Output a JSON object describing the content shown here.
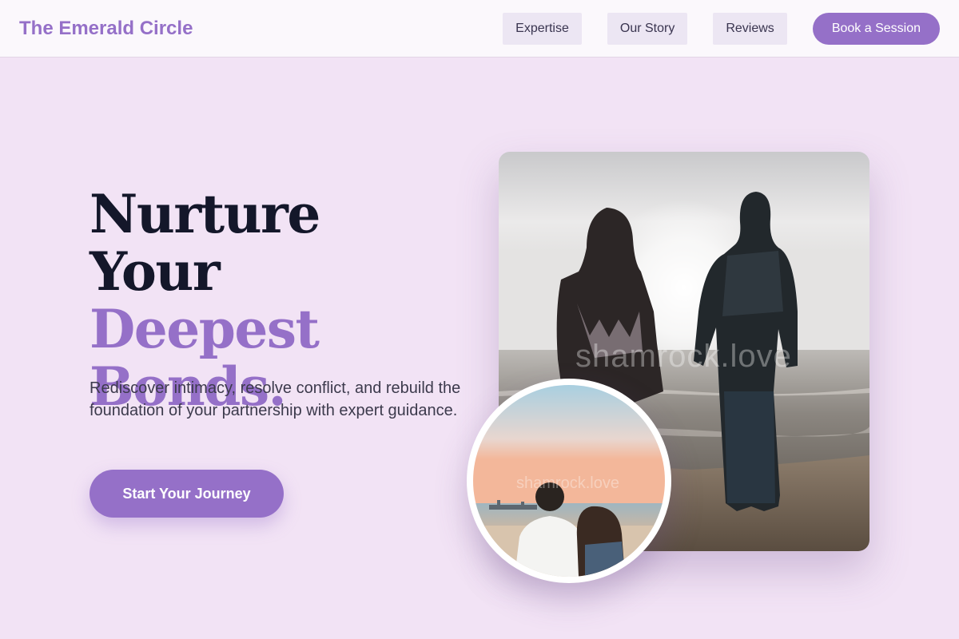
{
  "header": {
    "brand": "The Emerald Circle",
    "nav": [
      "Expertise",
      "Our Story",
      "Reviews"
    ],
    "cta": "Book a Session"
  },
  "hero": {
    "title_line1": "Nurture Your",
    "title_line2": "Deepest",
    "title_line3": "Bonds.",
    "subtitle": "Rediscover intimacy, resolve conflict, and rebuild the foundation of your partnership with expert guidance.",
    "cta": "Start Your Journey"
  },
  "images": {
    "main_watermark": "shamrock.love",
    "circle_watermark": "shamrock.love"
  },
  "colors": {
    "accent": "#9570c8",
    "background": "#f2e3f5",
    "heading": "#14172a"
  },
  "icons": [
    "couple-beach-photo",
    "couple-sunset-photo"
  ]
}
